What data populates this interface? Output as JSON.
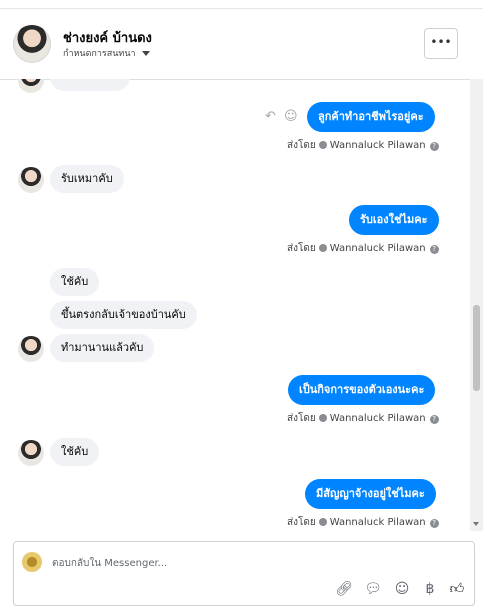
{
  "header": {
    "name": "ช่างยงค์ บ้านดง",
    "subtitle": "กำหนดการสนทนา"
  },
  "messages": [
    {
      "side": "out",
      "text": "ลูกค้าทำอาชีพไรอยู่คะ",
      "sent_by": "ส่งโดย",
      "agent": "Wannaluck Pilawan"
    },
    {
      "side": "in",
      "text": "รับเหมาคับ"
    },
    {
      "side": "out",
      "text": "รับเองใช่ไมคะ",
      "sent_by": "ส่งโดย",
      "agent": "Wannaluck Pilawan"
    },
    {
      "side": "in",
      "text": "ใช้คับ"
    },
    {
      "side": "in",
      "text": "ขึ้นตรงกลับเจ้าของบ้านคับ"
    },
    {
      "side": "in",
      "text": "ทำมานานแล้วคับ"
    },
    {
      "side": "out",
      "text": "เป็นกิจการของตัวเองนะคะ",
      "sent_by": "ส่งโดย",
      "agent": "Wannaluck Pilawan"
    },
    {
      "side": "in",
      "text": "ใช้คับ"
    },
    {
      "side": "out",
      "text": "มีสัญญาจ้างอยู่ใช่ไมคะ",
      "sent_by": "ส่งโดย",
      "agent": "Wannaluck Pilawan"
    }
  ],
  "composer": {
    "placeholder": "ตอบกลับใน Messenger..."
  },
  "icons": [
    "reply-icon",
    "emoji-icon",
    "attach-icon",
    "sticker-icon",
    "emoji-icon",
    "baht-icon",
    "like-icon",
    "more-icon"
  ]
}
